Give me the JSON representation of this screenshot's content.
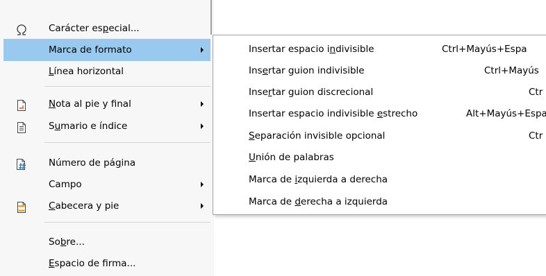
{
  "main_menu": {
    "items": [
      {
        "pre": "Carácter es",
        "u": "p",
        "post": "ecial...",
        "icon": "omega-icon"
      },
      {
        "pre": "Marca de formato",
        "u": "",
        "post": "",
        "highlighted": true,
        "submenu": true
      },
      {
        "pre": "",
        "u": "L",
        "post": "ínea horizontal"
      },
      {
        "pre": "",
        "u": "N",
        "post": "ota al pie y final",
        "submenu": true,
        "icon": "footnote-icon"
      },
      {
        "pre": "S",
        "u": "u",
        "post": "mario e índice",
        "submenu": true,
        "icon": "table-of-contents-icon"
      },
      {
        "pre": "Número de pá",
        "u": "g",
        "post": "ina",
        "icon": "page-number-icon"
      },
      {
        "pre": "Campo",
        "u": "",
        "post": "",
        "submenu": true
      },
      {
        "pre": "",
        "u": "C",
        "post": "abecera y pie",
        "submenu": true,
        "icon": "header-footer-icon"
      },
      {
        "pre": "So",
        "u": "b",
        "post": "re..."
      },
      {
        "pre": "",
        "u": "E",
        "post": "spacio de firma..."
      }
    ]
  },
  "submenu": {
    "items": [
      {
        "pre": "Insertar espacio i",
        "u": "n",
        "post": "divisible",
        "shortcut": "Ctrl+Mayús+Espa"
      },
      {
        "pre": "Ins",
        "u": "e",
        "post": "rtar guion indivisible",
        "shortcut": "Ctrl+Mayús"
      },
      {
        "pre": "Inse",
        "u": "r",
        "post": "tar guion discrecional",
        "shortcut": "Ctr"
      },
      {
        "pre": "Insertar espacio indivisible ",
        "u": "e",
        "post": "strecho",
        "shortcut": "Alt+Mayús+Espa"
      },
      {
        "pre": "",
        "u": "S",
        "post": "eparación invisible opcional",
        "shortcut": "Ctr"
      },
      {
        "pre": "",
        "u": "U",
        "post": "nión de palabras",
        "shortcut": ""
      },
      {
        "pre": "Marca de ",
        "u": "i",
        "post": "zquierda a derecha",
        "shortcut": ""
      },
      {
        "pre": "Marca de ",
        "u": "d",
        "post": "erecha a izquierda",
        "shortcut": ""
      }
    ]
  },
  "colors": {
    "highlight": "#99c9ef",
    "menu_background": "#f7f7f7",
    "icon_red": "#d9452b",
    "icon_orange": "#e6a12a",
    "icon_blue": "#2d6fb7"
  }
}
